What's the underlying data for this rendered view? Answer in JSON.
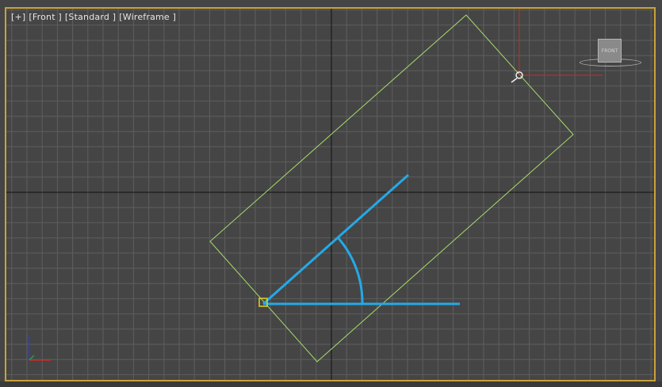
{
  "viewport": {
    "label_parts": [
      "[+]",
      "[Front ]",
      "[Standard ]",
      "[Wireframe ]"
    ]
  },
  "viewcube": {
    "face_label": "FRONT"
  },
  "colors": {
    "background": "#454545",
    "grid": "#5e5e5e",
    "grid_axis": "#111111",
    "frame": "#c9a23a",
    "wireframe": "#a7d96c",
    "measure": "#24a9e8",
    "gizmo_x": "#cc2b2b",
    "gizmo_y": "#2b3fcc",
    "gizmo_z": "#2b9e3f"
  },
  "axis_triad": {
    "x": "x",
    "y": "y",
    "z": "z"
  },
  "icons": [
    "viewcube-icon",
    "axis-triad-icon",
    "pivot-gizmo-icon"
  ]
}
